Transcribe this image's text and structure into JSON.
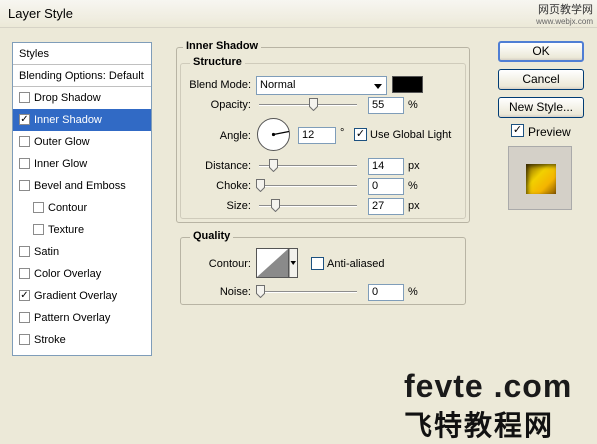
{
  "window": {
    "title": "Layer Style",
    "watermark_top_line1": "网页教学网",
    "watermark_top_line2": "www.webjx.com"
  },
  "styles_list": {
    "header": "Styles",
    "blending": "Blending Options: Default",
    "items": [
      {
        "label": "Drop Shadow",
        "checked": false
      },
      {
        "label": "Inner Shadow",
        "checked": true,
        "selected": true
      },
      {
        "label": "Outer Glow",
        "checked": false
      },
      {
        "label": "Inner Glow",
        "checked": false
      },
      {
        "label": "Bevel and Emboss",
        "checked": false
      },
      {
        "label": "Contour",
        "checked": false,
        "indent": true
      },
      {
        "label": "Texture",
        "checked": false,
        "indent": true
      },
      {
        "label": "Satin",
        "checked": false
      },
      {
        "label": "Color Overlay",
        "checked": false
      },
      {
        "label": "Gradient Overlay",
        "checked": true
      },
      {
        "label": "Pattern Overlay",
        "checked": false
      },
      {
        "label": "Stroke",
        "checked": false
      }
    ]
  },
  "inner_shadow": {
    "title": "Inner Shadow",
    "structure_title": "Structure",
    "blend_mode_label": "Blend Mode:",
    "blend_mode_value": "Normal",
    "shadow_color": "#000000",
    "opacity_label": "Opacity:",
    "opacity_value": "55",
    "opacity_unit": "%",
    "opacity_level": 0.55,
    "angle_label": "Angle:",
    "angle_value": "12",
    "angle_unit": "°",
    "use_global_light_label": "Use Global Light",
    "use_global_light": true,
    "distance_label": "Distance:",
    "distance_value": "14",
    "distance_unit": "px",
    "choke_label": "Choke:",
    "choke_value": "0",
    "choke_unit": "%",
    "size_label": "Size:",
    "size_value": "27",
    "size_unit": "px"
  },
  "quality": {
    "title": "Quality",
    "contour_label": "Contour:",
    "anti_aliased_label": "Anti-aliased",
    "anti_aliased": false,
    "noise_label": "Noise:",
    "noise_value": "0",
    "noise_unit": "%"
  },
  "buttons": {
    "ok": "OK",
    "cancel": "Cancel",
    "new_style": "New Style...",
    "preview_label": "Preview",
    "preview_checked": true
  },
  "watermark": {
    "brand": "fevte .com",
    "brand_cn": "飞特教程网"
  },
  "colors": {
    "selection": "#316ac5",
    "dialog_bg": "#ece9d8",
    "preview_gold": "#f2d000"
  }
}
